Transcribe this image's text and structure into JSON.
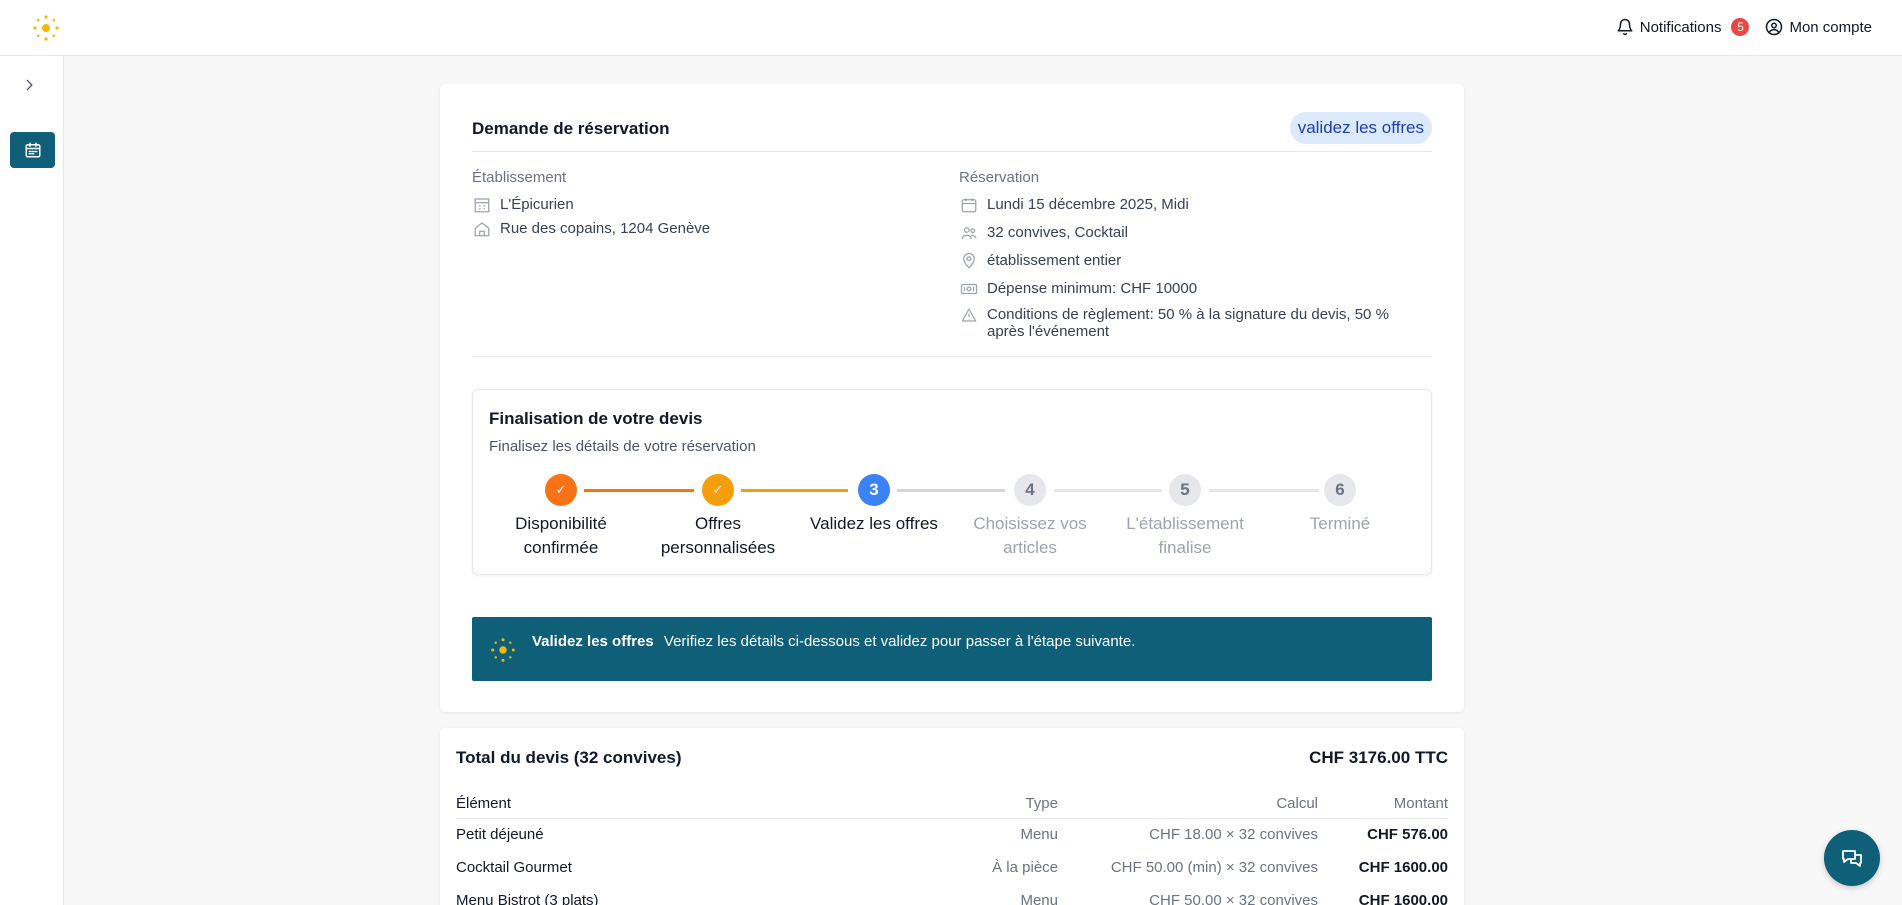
{
  "header": {
    "logo_icon": "sun-logo-icon",
    "notifications_label": "Notifications",
    "notifications_count": "5",
    "account_label": "Mon compte"
  },
  "sidebar": {
    "toggle_icon": "chevron-right-icon",
    "items": [
      {
        "icon": "calendar-icon",
        "active": true
      }
    ]
  },
  "request": {
    "title": "Demande de réservation",
    "status": "validez les offres",
    "establishment": {
      "label": "Établissement",
      "name": "L'Épicurien",
      "address": "Rue des copains, 1204 Genève"
    },
    "reservation": {
      "label": "Réservation",
      "date": "Lundi 15 décembre 2025, Midi",
      "guests": "32 convives, Cocktail",
      "space": "établissement entier",
      "min_spend": "Dépense minimum: CHF 10000",
      "payment_terms": "Conditions de règlement: 50 % à la signature du devis, 50 % après l'événement"
    }
  },
  "stepper": {
    "title": "Finalisation de votre devis",
    "subtitle": "Finalisez les détails de votre réservation",
    "steps": [
      {
        "number": "1",
        "label_line1": "Disponibilité",
        "label_line2": "confirmée",
        "state": "done"
      },
      {
        "number": "2",
        "label_line1": "Offres",
        "label_line2": "personnalisées",
        "state": "done"
      },
      {
        "number": "3",
        "label_line1": "Validez les offres",
        "label_line2": "",
        "state": "current"
      },
      {
        "number": "4",
        "label_line1": "Choisissez vos",
        "label_line2": "articles",
        "state": "todo"
      },
      {
        "number": "5",
        "label_line1": "L'établissement",
        "label_line2": "finalise",
        "state": "todo"
      },
      {
        "number": "6",
        "label_line1": "Terminé",
        "label_line2": "",
        "state": "todo"
      }
    ],
    "check_glyph": "✓"
  },
  "banner": {
    "title": "Validez les offres",
    "text": "Verifiez les détails ci-dessous et validez pour passer à l'étape suivante."
  },
  "quote": {
    "title": "Total du devis (32 convives)",
    "total": "CHF 3176.00 TTC",
    "columns": [
      "Élément",
      "Type",
      "Calcul",
      "Montant"
    ],
    "rows": [
      {
        "element": "Petit déjeuné",
        "type": "Menu",
        "calc": "CHF 18.00 × 32 convives",
        "amount": "CHF 576.00"
      },
      {
        "element": "Cocktail Gourmet",
        "type": "À la pièce",
        "calc": "CHF 50.00 (min) × 32 convives",
        "amount": "CHF 1600.00"
      },
      {
        "element": "Menu Bistrot (3 plats)",
        "type": "Menu",
        "calc": "CHF 50.00 × 32 convives",
        "amount": "CHF 1600.00"
      }
    ]
  },
  "colors": {
    "brand_teal": "#0e5f77",
    "step_done_1": "#f97316",
    "step_done_2": "#f59e0b",
    "step_current": "#3b82f6",
    "step_todo": "#e5e7eb",
    "badge_red": "#ef4444",
    "logo_yellow": "#f5b800"
  },
  "chat_button_icon": "chat-bubbles-icon"
}
